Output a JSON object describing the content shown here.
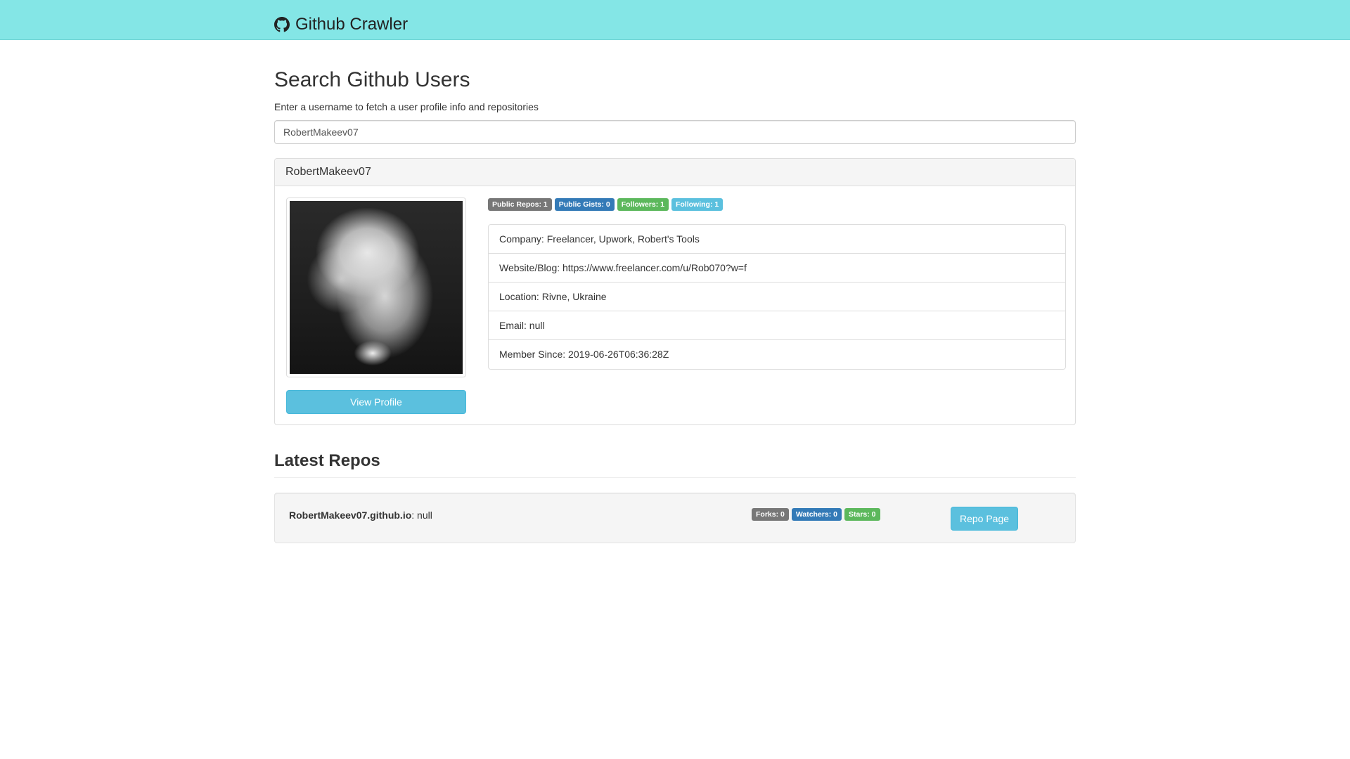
{
  "navbar": {
    "brand": "Github Crawler",
    "icon": "github-icon",
    "background": "#84e6e6"
  },
  "search": {
    "title": "Search Github Users",
    "subtitle": "Enter a username to fetch a user profile info and repositories",
    "value": "RobertMakeev07"
  },
  "profile": {
    "heading": "RobertMakeev07",
    "view_profile_label": "View Profile",
    "badges": [
      {
        "label": "Public Repos: 1",
        "color": "#777777"
      },
      {
        "label": "Public Gists: 0",
        "color": "#337ab7"
      },
      {
        "label": "Followers: 1",
        "color": "#5cb85c"
      },
      {
        "label": "Following: 1",
        "color": "#5bc0de"
      }
    ],
    "details": [
      "Company: Freelancer, Upwork, Robert's Tools",
      "Website/Blog: https://www.freelancer.com/u/Rob070?w=f",
      "Location: Rivne, Ukraine",
      "Email: null",
      "Member Since: 2019-06-26T06:36:28Z"
    ]
  },
  "repos": {
    "title": "Latest Repos",
    "items": [
      {
        "name": "RobertMakeev07.github.io",
        "description": ": null",
        "badges": [
          {
            "label": "Forks: 0",
            "color": "#777777"
          },
          {
            "label": "Watchers: 0",
            "color": "#337ab7"
          },
          {
            "label": "Stars: 0",
            "color": "#5cb85c"
          }
        ],
        "button_label": "Repo Page"
      }
    ]
  }
}
